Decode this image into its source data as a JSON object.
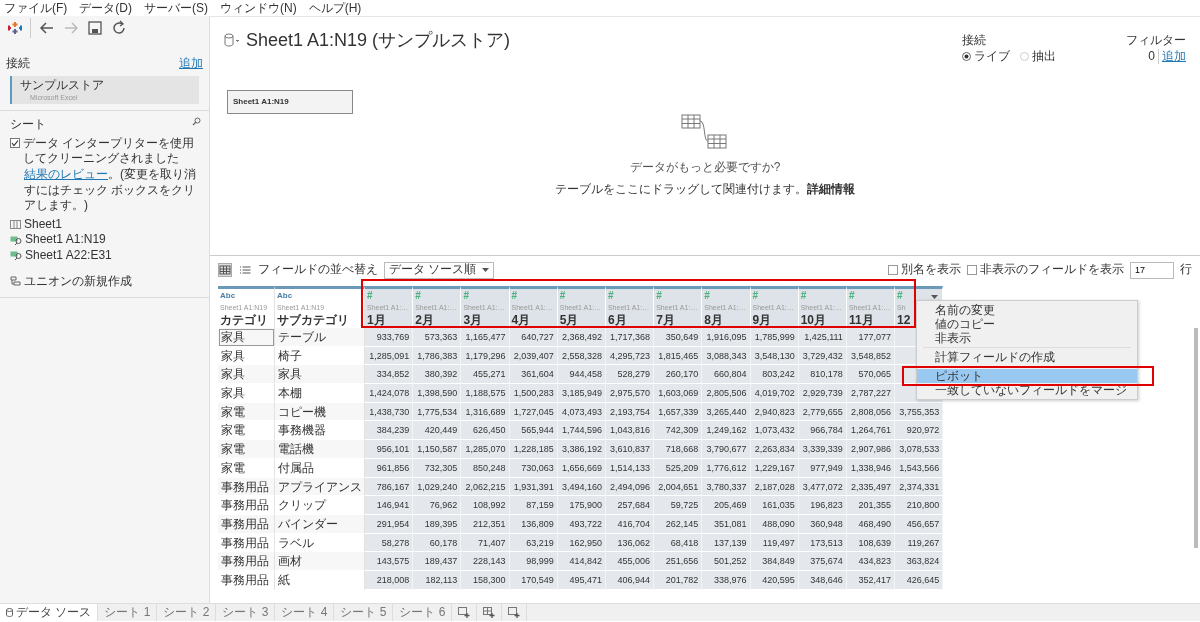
{
  "menu_bar": [
    "ファイル(F)",
    "データ(D)",
    "サーバー(S)",
    "ウィンドウ(N)",
    "ヘルプ(H)"
  ],
  "toolbar": [
    {
      "kind": "back",
      "disabled": false
    },
    {
      "kind": "forward",
      "disabled": true
    },
    {
      "kind": "save",
      "disabled": false
    },
    {
      "kind": "refresh",
      "disabled": false
    }
  ],
  "sidebar": {
    "connections_label": "接続",
    "add_link": "追加",
    "connection": {
      "name": "サンプルストア",
      "type": "Microsoft Excel"
    },
    "sheets_label": "シート",
    "interpreter": {
      "checked": true,
      "label": "データ インタープリターを使用してクリーニングされました",
      "link": "結果のレビュー",
      "note": "。(変更を取り消すにはチェック ボックスをクリアします。)"
    },
    "sheets": [
      {
        "name": "Sheet1",
        "kind": "sheet"
      },
      {
        "name": "Sheet1 A1:N19",
        "kind": "range"
      },
      {
        "name": "Sheet1 A22:E31",
        "kind": "range"
      }
    ],
    "new_union": "ユニオンの新規作成"
  },
  "header": {
    "title": "Sheet1 A1:N19 (サンプルストア)",
    "connection_label": "接続",
    "connection_modes": [
      {
        "label": "ライブ",
        "selected": true
      },
      {
        "label": "抽出",
        "selected": false
      }
    ],
    "filters_label": "フィルター",
    "filters_count": "0",
    "filters_add": "追加"
  },
  "canvas": {
    "table": "Sheet1 A1:N19",
    "prompt": "データがもっと必要ですか?",
    "hint": "テーブルをここにドラッグして関連付けます。",
    "hint_link": "詳細情報"
  },
  "grid_toolbar": {
    "views": [
      {
        "kind": "grid",
        "selected": true
      },
      {
        "kind": "list",
        "selected": false
      }
    ],
    "sort_label": "フィールドの並べ替え",
    "sort_value": "データ ソース順",
    "options": [
      {
        "label": "別名を表示",
        "checked": false
      },
      {
        "label": "非表示のフィールドを表示",
        "checked": false
      }
    ],
    "rows_value": "17",
    "rows_label": "行"
  },
  "table": {
    "columns": [
      {
        "type": "Abc",
        "source": "Sheet1 A1:N19",
        "name": "カテゴリ",
        "kind": "text"
      },
      {
        "type": "Abc",
        "source": "Sheet1 A1:N19",
        "name": "サブカテゴリ",
        "kind": "text"
      },
      {
        "type": "#",
        "source": "Sheet1 A1:…",
        "name": "1月",
        "kind": "number"
      },
      {
        "type": "#",
        "source": "Sheet1 A1:…",
        "name": "2月",
        "kind": "number"
      },
      {
        "type": "#",
        "source": "Sheet1 A1:…",
        "name": "3月",
        "kind": "number"
      },
      {
        "type": "#",
        "source": "Sheet1 A1:…",
        "name": "4月",
        "kind": "number"
      },
      {
        "type": "#",
        "source": "Sheet1 A1:…",
        "name": "5月",
        "kind": "number"
      },
      {
        "type": "#",
        "source": "Sheet1 A1:…",
        "name": "6月",
        "kind": "number"
      },
      {
        "type": "#",
        "source": "Sheet1 A1:…",
        "name": "7月",
        "kind": "number"
      },
      {
        "type": "#",
        "source": "Sheet1 A1:…",
        "name": "8月",
        "kind": "number"
      },
      {
        "type": "#",
        "source": "Sheet1 A1:…",
        "name": "9月",
        "kind": "number"
      },
      {
        "type": "#",
        "source": "Sheet1 A1:…",
        "name": "10月",
        "kind": "number"
      },
      {
        "type": "#",
        "source": "Sheet1 A1:…",
        "name": "11月",
        "kind": "number"
      },
      {
        "type": "#",
        "source": "Sh",
        "name": "12",
        "kind": "number"
      }
    ],
    "month_headers_highlighted": true,
    "rows": [
      {
        "focused": true,
        "cells": [
          "家具",
          "テーブル",
          "933,769",
          "573,363",
          "1,165,477",
          "640,727",
          "2,368,492",
          "1,717,368",
          "350,649",
          "1,916,095",
          "1,785,999",
          "1,425,111",
          "177,077",
          null
        ]
      },
      {
        "focused": false,
        "cells": [
          "家具",
          "椅子",
          "1,285,091",
          "1,786,383",
          "1,179,296",
          "2,039,407",
          "2,558,328",
          "4,295,723",
          "1,815,465",
          "3,088,343",
          "3,548,130",
          "3,729,432",
          "3,548,852",
          null
        ]
      },
      {
        "focused": false,
        "cells": [
          "家具",
          "家具",
          "334,852",
          "380,392",
          "455,271",
          "361,604",
          "944,458",
          "528,279",
          "260,170",
          "660,804",
          "803,242",
          "810,178",
          "570,065",
          null
        ]
      },
      {
        "focused": false,
        "cells": [
          "家具",
          "本棚",
          "1,424,078",
          "1,398,590",
          "1,188,575",
          "1,500,283",
          "3,185,949",
          "2,975,570",
          "1,603,069",
          "2,805,506",
          "4,019,702",
          "2,929,739",
          "2,787,227",
          null
        ]
      },
      {
        "focused": false,
        "cells": [
          "家電",
          "コピー機",
          "1,438,730",
          "1,775,534",
          "1,316,689",
          "1,727,045",
          "4,073,493",
          "2,193,754",
          "1,657,339",
          "3,265,440",
          "2,940,823",
          "2,779,655",
          "2,808,056",
          "3,755,353"
        ]
      },
      {
        "focused": false,
        "cells": [
          "家電",
          "事務機器",
          "384,239",
          "420,449",
          "626,450",
          "565,944",
          "1,744,596",
          "1,043,816",
          "742,309",
          "1,249,162",
          "1,073,432",
          "966,784",
          "1,264,761",
          "920,972"
        ]
      },
      {
        "focused": false,
        "cells": [
          "家電",
          "電話機",
          "956,101",
          "1,150,587",
          "1,285,070",
          "1,228,185",
          "3,386,192",
          "3,610,837",
          "718,668",
          "3,790,677",
          "2,263,834",
          "3,339,339",
          "2,907,986",
          "3,078,533"
        ]
      },
      {
        "focused": false,
        "cells": [
          "家電",
          "付属品",
          "961,856",
          "732,305",
          "850,248",
          "730,063",
          "1,656,669",
          "1,514,133",
          "525,209",
          "1,776,612",
          "1,229,167",
          "977,949",
          "1,338,946",
          "1,543,566"
        ]
      },
      {
        "focused": false,
        "cells": [
          "事務用品",
          "アプライアンス",
          "786,167",
          "1,029,240",
          "2,062,215",
          "1,931,391",
          "3,494,160",
          "2,494,096",
          "2,004,651",
          "3,780,337",
          "2,187,028",
          "3,477,072",
          "2,335,497",
          "2,374,331"
        ]
      },
      {
        "focused": false,
        "cells": [
          "事務用品",
          "クリップ",
          "146,941",
          "76,962",
          "108,992",
          "87,159",
          "175,900",
          "257,684",
          "59,725",
          "205,469",
          "161,035",
          "196,823",
          "201,355",
          "210,800"
        ]
      },
      {
        "focused": false,
        "cells": [
          "事務用品",
          "バインダー",
          "291,954",
          "189,395",
          "212,351",
          "136,809",
          "493,722",
          "416,704",
          "262,145",
          "351,081",
          "488,090",
          "360,948",
          "468,490",
          "456,657"
        ]
      },
      {
        "focused": false,
        "cells": [
          "事務用品",
          "ラベル",
          "58,278",
          "60,178",
          "71,407",
          "63,219",
          "162,950",
          "136,062",
          "68,418",
          "137,139",
          "119,497",
          "173,513",
          "108,639",
          "119,267"
        ]
      },
      {
        "focused": false,
        "cells": [
          "事務用品",
          "画材",
          "143,575",
          "189,437",
          "228,143",
          "98,999",
          "414,842",
          "455,006",
          "251,656",
          "501,252",
          "384,849",
          "375,674",
          "434,823",
          "363,824"
        ]
      },
      {
        "focused": false,
        "cells": [
          "事務用品",
          "紙",
          "218,008",
          "182,113",
          "158,300",
          "170,549",
          "495,471",
          "406,944",
          "201,782",
          "338,976",
          "420,595",
          "348,646",
          "352,417",
          "426,645"
        ]
      }
    ]
  },
  "context_menu": [
    {
      "label": "名前の変更",
      "highlighted": false,
      "separator_after": false
    },
    {
      "label": "値のコピー",
      "highlighted": false,
      "separator_after": false
    },
    {
      "label": "非表示",
      "highlighted": false,
      "separator_after": true
    },
    {
      "label": "計算フィールドの作成",
      "highlighted": false,
      "separator_after": true
    },
    {
      "label": "ピボット",
      "highlighted": true,
      "separator_after": false
    },
    {
      "label": "一致していないフィールドをマージ",
      "highlighted": false,
      "separator_after": false
    }
  ],
  "bottom_tabs": [
    {
      "label": "データ ソース",
      "kind": "datasource",
      "selected": true
    },
    {
      "label": "シート 1",
      "kind": "sheet",
      "selected": false
    },
    {
      "label": "シート 2",
      "kind": "sheet",
      "selected": false
    },
    {
      "label": "シート 3",
      "kind": "sheet",
      "selected": false
    },
    {
      "label": "シート 4",
      "kind": "sheet",
      "selected": false
    },
    {
      "label": "シート 5",
      "kind": "sheet",
      "selected": false
    },
    {
      "label": "シート 6",
      "kind": "sheet",
      "selected": false
    },
    {
      "kind": "new-sheet"
    },
    {
      "kind": "new-dashboard"
    },
    {
      "kind": "new-story"
    }
  ]
}
